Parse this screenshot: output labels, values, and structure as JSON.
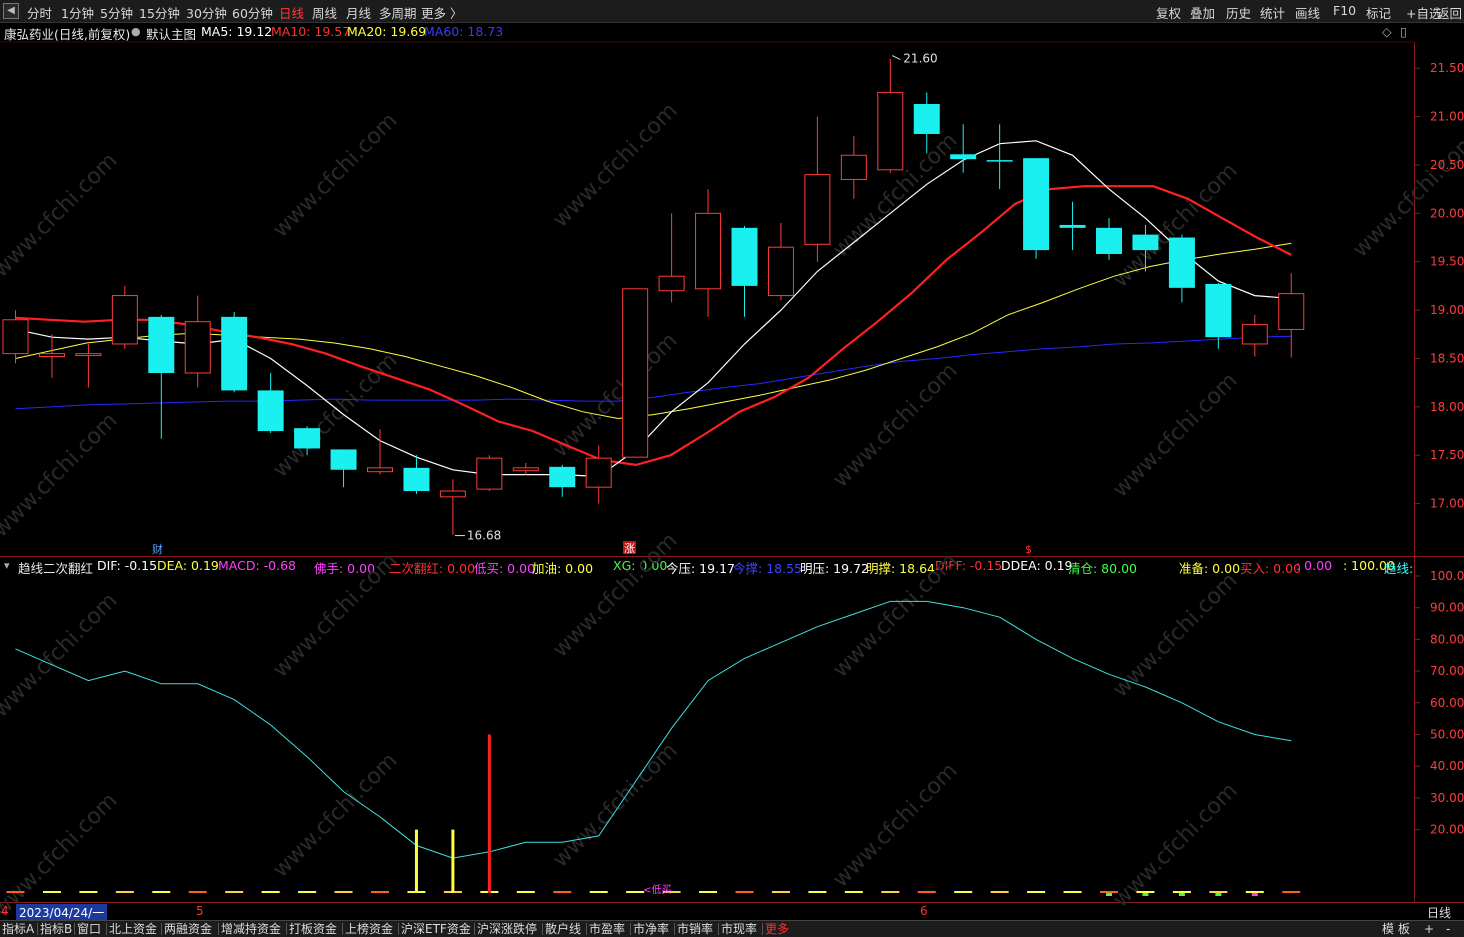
{
  "toolbar": {
    "back_symbol": "◀",
    "period_tabs": [
      "分时",
      "1分钟",
      "5分钟",
      "15分钟",
      "30分钟",
      "60分钟",
      "日线",
      "周线",
      "月线",
      "多周期",
      "更多 〉"
    ],
    "active_tab": "日线",
    "right_buttons": [
      "复权",
      "叠加",
      "历史",
      "统计",
      "画线",
      "F10",
      "标记",
      "+自选",
      "返回"
    ]
  },
  "main_chart": {
    "stock_title": "康弘药业(日线,前复权)",
    "template_label": "默认主图",
    "ma5": "MA5: 19.12",
    "ma10": "MA10: 19.57",
    "ma20": "MA20: 19.69",
    "ma60": "MA60: 18.73",
    "high_label": "21.60",
    "low_label": "16.68",
    "price_axis": [
      "21.50",
      "21.00",
      "20.50",
      "20.00",
      "19.50",
      "19.00",
      "18.50",
      "18.00",
      "17.50",
      "17.00"
    ],
    "markers": [
      "财",
      "涨",
      "$"
    ],
    "colors": {
      "up": "#ff3c3c",
      "down": "#1bf0f0",
      "ma5": "#ffffff",
      "ma10": "#ff2020",
      "ma20": "#ffff40",
      "ma60": "#2828ff"
    }
  },
  "indicator": {
    "name": "趋线二次翻红",
    "values": [
      {
        "label": "DIF: -0.15",
        "color": "#ffffff"
      },
      {
        "label": "DEA: 0.19",
        "color": "#ffff40"
      },
      {
        "label": "MACD: -0.68",
        "color": "#ff40ff"
      },
      {
        "label": "佛手: 0.00",
        "color": "#ff40ff"
      },
      {
        "label": "二次翻红: 0.00",
        "color": "#ff3030"
      },
      {
        "label": "低买: 0.00",
        "color": "#ff40ff"
      },
      {
        "label": "加油: 0.00",
        "color": "#ffff40"
      },
      {
        "label": "XG: 0.00",
        "color": "#40ff40"
      },
      {
        "label": "今压: 19.17",
        "color": "#ffffff"
      },
      {
        "label": "今撑: 18.55",
        "color": "#4040ff"
      },
      {
        "label": "明压: 19.72",
        "color": "#ffffff"
      },
      {
        "label": "明撑: 18.64",
        "color": "#ffff40"
      },
      {
        "label": "DIFF: -0.15",
        "color": "#ff3030"
      },
      {
        "label": "DDEA: 0.19",
        "color": "#ffffff"
      },
      {
        "label": "清仓: 80.00",
        "color": "#40ff40"
      },
      {
        "label": "准备: 0.00",
        "color": "#ffff40"
      },
      {
        "label": "买入: 0.00",
        "color": "#ff3030"
      },
      {
        "label": ": 0.00",
        "color": "#ff40ff"
      },
      {
        "label": ": 100.00",
        "color": "#ffff40"
      },
      {
        "label": "趋线:",
        "color": "#40ffff"
      }
    ],
    "axis": [
      "100.00",
      "90.00",
      "80.00",
      "70.00",
      "60.00",
      "50.00",
      "40.00",
      "30.00",
      "20.00"
    ],
    "low_buy_tag": "低买"
  },
  "date_axis": {
    "current_date": "2023/04/24/一",
    "month_marks": [
      "5",
      "6"
    ],
    "period_label": "日线"
  },
  "bottom_tabs": [
    "指标A",
    "指标B",
    "窗口",
    "北上资金",
    "两融资金",
    "增减持资金",
    "打板资金",
    "上榜资金",
    "沪深ETF资金",
    "沪深涨跌停",
    "散户线",
    "市盈率",
    "市净率",
    "市销率",
    "市现率",
    "更多"
  ],
  "bottom_right": [
    "模 板",
    "+",
    "-"
  ],
  "watermark": "www.cfchi.com",
  "chart_data": {
    "type": "candlestick",
    "candles": [
      {
        "o": 18.55,
        "c": 18.9,
        "h": 19.0,
        "l": 18.45
      },
      {
        "o": 18.52,
        "c": 18.55,
        "h": 18.75,
        "l": 18.3
      },
      {
        "o": 18.53,
        "c": 18.55,
        "h": 18.65,
        "l": 18.2
      },
      {
        "o": 18.65,
        "c": 19.15,
        "h": 19.25,
        "l": 18.6
      },
      {
        "o": 18.93,
        "c": 18.35,
        "h": 18.95,
        "l": 17.67
      },
      {
        "o": 18.35,
        "c": 18.88,
        "h": 19.15,
        "l": 18.2
      },
      {
        "o": 18.93,
        "c": 18.17,
        "h": 18.98,
        "l": 18.15
      },
      {
        "o": 18.17,
        "c": 17.75,
        "h": 18.35,
        "l": 17.73
      },
      {
        "o": 17.78,
        "c": 17.57,
        "h": 17.8,
        "l": 17.5
      },
      {
        "o": 17.56,
        "c": 17.35,
        "h": 17.56,
        "l": 17.17
      },
      {
        "o": 17.33,
        "c": 17.37,
        "h": 17.77,
        "l": 17.3
      },
      {
        "o": 17.37,
        "c": 17.13,
        "h": 17.5,
        "l": 17.1
      },
      {
        "o": 17.07,
        "c": 17.13,
        "h": 17.25,
        "l": 16.68
      },
      {
        "o": 17.15,
        "c": 17.47,
        "h": 17.5,
        "l": 17.13
      },
      {
        "o": 17.34,
        "c": 17.37,
        "h": 17.42,
        "l": 17.3
      },
      {
        "o": 17.38,
        "c": 17.17,
        "h": 17.4,
        "l": 17.07
      },
      {
        "o": 17.17,
        "c": 17.47,
        "h": 17.6,
        "l": 17.0
      },
      {
        "o": 17.48,
        "c": 19.22,
        "h": 19.22,
        "l": 17.48
      },
      {
        "o": 19.2,
        "c": 19.35,
        "h": 20.0,
        "l": 19.08
      },
      {
        "o": 19.22,
        "c": 20.0,
        "h": 20.25,
        "l": 18.93
      },
      {
        "o": 19.85,
        "c": 19.25,
        "h": 19.87,
        "l": 18.93
      },
      {
        "o": 19.15,
        "c": 19.65,
        "h": 19.9,
        "l": 19.1
      },
      {
        "o": 19.68,
        "c": 20.4,
        "h": 21.0,
        "l": 19.5
      },
      {
        "o": 20.35,
        "c": 20.6,
        "h": 20.8,
        "l": 20.15
      },
      {
        "o": 20.45,
        "c": 21.25,
        "h": 21.6,
        "l": 20.42
      },
      {
        "o": 21.13,
        "c": 20.82,
        "h": 21.25,
        "l": 20.62
      },
      {
        "o": 20.61,
        "c": 20.56,
        "h": 20.92,
        "l": 20.42
      },
      {
        "o": 20.55,
        "c": 20.54,
        "h": 20.92,
        "l": 20.25
      },
      {
        "o": 20.57,
        "c": 19.62,
        "h": 20.57,
        "l": 19.53
      },
      {
        "o": 19.88,
        "c": 19.85,
        "h": 20.12,
        "l": 19.62
      },
      {
        "o": 19.85,
        "c": 19.58,
        "h": 19.95,
        "l": 19.52
      },
      {
        "o": 19.78,
        "c": 19.62,
        "h": 19.88,
        "l": 19.4
      },
      {
        "o": 19.75,
        "c": 19.23,
        "h": 19.78,
        "l": 19.08
      },
      {
        "o": 19.27,
        "c": 18.72,
        "h": 19.28,
        "l": 18.6
      },
      {
        "o": 18.65,
        "c": 18.85,
        "h": 18.95,
        "l": 18.52
      },
      {
        "o": 18.8,
        "c": 19.17,
        "h": 19.38,
        "l": 18.51
      }
    ],
    "ma5": [
      18.8,
      18.72,
      18.7,
      18.72,
      18.68,
      18.65,
      18.7,
      18.5,
      18.22,
      17.92,
      17.65,
      17.48,
      17.35,
      17.3,
      17.3,
      17.3,
      17.28,
      17.55,
      17.95,
      18.25,
      18.65,
      19.0,
      19.4,
      19.7,
      20.0,
      20.3,
      20.55,
      20.72,
      20.75,
      20.6,
      20.25,
      19.95,
      19.6,
      19.3,
      19.15,
      19.12
    ],
    "ma10": [
      18.92,
      18.9,
      18.88,
      18.9,
      18.9,
      18.85,
      18.78,
      18.72,
      18.65,
      18.55,
      18.42,
      18.3,
      18.18,
      18.02,
      17.85,
      17.75,
      17.6,
      17.45,
      17.4,
      17.5,
      17.72,
      17.95,
      18.1,
      18.3,
      18.6,
      18.88,
      19.18,
      19.52,
      19.8,
      20.1,
      20.25,
      20.28,
      20.28,
      20.28,
      20.15,
      19.95,
      19.75,
      19.57
    ],
    "ma20": [
      18.5,
      18.58,
      18.66,
      18.7,
      18.74,
      18.76,
      18.74,
      18.72,
      18.7,
      18.66,
      18.6,
      18.52,
      18.42,
      18.32,
      18.2,
      18.06,
      17.95,
      17.88,
      17.92,
      17.98,
      18.05,
      18.12,
      18.2,
      18.28,
      18.38,
      18.5,
      18.62,
      18.76,
      18.95,
      19.08,
      19.22,
      19.35,
      19.45,
      19.52,
      19.58,
      19.63,
      19.69
    ],
    "ma60": [
      17.98,
      18.0,
      18.02,
      18.03,
      18.04,
      18.05,
      18.06,
      18.06,
      18.07,
      18.08,
      18.07,
      18.07,
      18.07,
      18.07,
      18.08,
      18.07,
      18.06,
      18.06,
      18.1,
      18.15,
      18.2,
      18.24,
      18.3,
      18.36,
      18.42,
      18.47,
      18.5,
      18.54,
      18.57,
      18.6,
      18.62,
      18.65,
      18.66,
      18.68,
      18.7,
      18.72,
      18.73
    ],
    "trend_line": [
      77,
      72,
      67,
      70,
      66,
      66,
      61,
      53,
      43,
      32,
      24,
      15,
      11,
      13,
      16,
      16,
      18,
      35,
      52,
      67,
      74,
      79,
      84,
      88,
      92,
      92,
      90,
      87,
      80,
      74,
      69,
      65,
      60,
      54,
      50,
      48
    ],
    "ind_bars": [
      {
        "i": 11,
        "v": 20,
        "color": "#ffff40"
      },
      {
        "i": 12,
        "v": 20,
        "color": "#ffff40"
      },
      {
        "i": 13,
        "v": 50,
        "color": "#ff2020"
      }
    ],
    "ylim": [
      16.5,
      21.75
    ],
    "ind_ylim": [
      0,
      100
    ]
  }
}
